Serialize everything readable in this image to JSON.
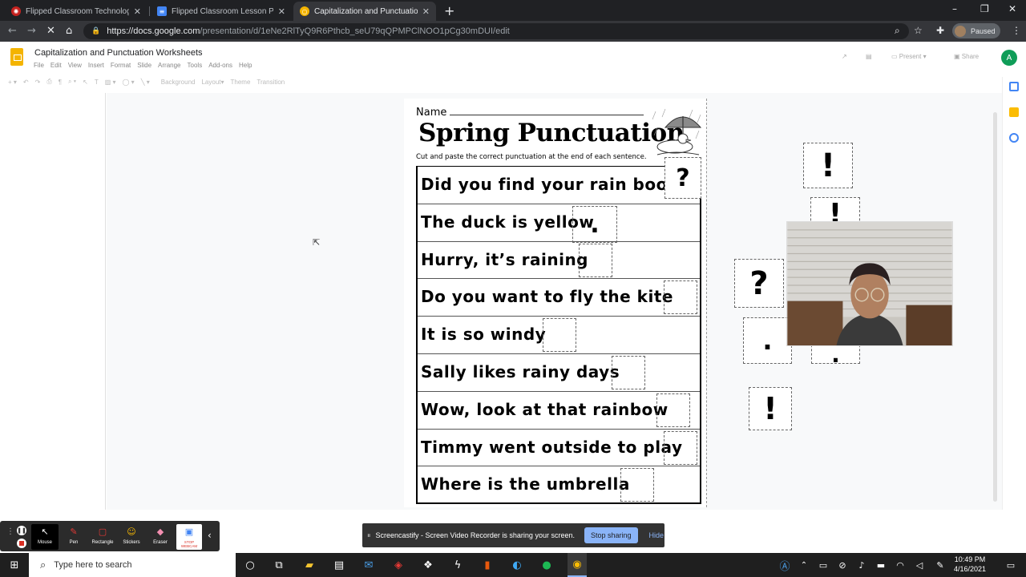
{
  "browser": {
    "tabs": [
      {
        "label": "Flipped Classroom Technology A",
        "icon": "flipped-icon",
        "active": false
      },
      {
        "label": "Flipped Classroom Lesson Plan T",
        "icon": "docs-icon",
        "active": false
      },
      {
        "label": "Capitalization and Punctuation W",
        "icon": "slides-icon",
        "active": true
      }
    ],
    "url_prefix": "https://docs.google.com",
    "url_rest": "/presentation/d/1eNe2RlTyQ9R6Pthcb_seU79qQPMPClNOO1pCg30mDUI/edit",
    "profile_status": "Paused"
  },
  "doc": {
    "title": "Capitalization and Punctuation Worksheets",
    "menu": [
      "File",
      "Edit",
      "View",
      "Insert",
      "Format",
      "Slide",
      "Arrange",
      "Tools",
      "Add-ons",
      "Help"
    ],
    "present_label": "Present",
    "share_label": "Share",
    "avatar_letter": "A",
    "toolbar": {
      "background": "Background",
      "layout": "Layout",
      "theme": "Theme",
      "transition": "Transition"
    }
  },
  "worksheet": {
    "name_label": "Name",
    "title": "Spring Punctuation",
    "instructions": "Cut and paste the correct punctuation at the end of each sentence.",
    "sentences": [
      "Did you find your rain boots",
      "The duck is yellow",
      "Hurry, it’s raining",
      "Do you want to fly the kite",
      "It is so windy",
      "Sally likes rainy days",
      "Wow, look at that rainbow",
      "Timmy went outside to play",
      "Where is the umbrella"
    ]
  },
  "punctuation_pieces": {
    "question_placed": "?",
    "period_placed": ".",
    "loose": [
      "!",
      "!",
      "?",
      ".",
      ".",
      "!"
    ]
  },
  "screencastify": {
    "tools": [
      "Mouse",
      "Pen",
      "Rectangle",
      "Stickers",
      "Eraser",
      "STOP WEBCAM"
    ],
    "share_message": "Screencastify - Screen Video Recorder is sharing your screen.",
    "stop_label": "Stop sharing",
    "hide_label": "Hide"
  },
  "taskbar": {
    "search_placeholder": "Type here to search",
    "time": "10:49 PM",
    "date": "4/16/2021"
  }
}
